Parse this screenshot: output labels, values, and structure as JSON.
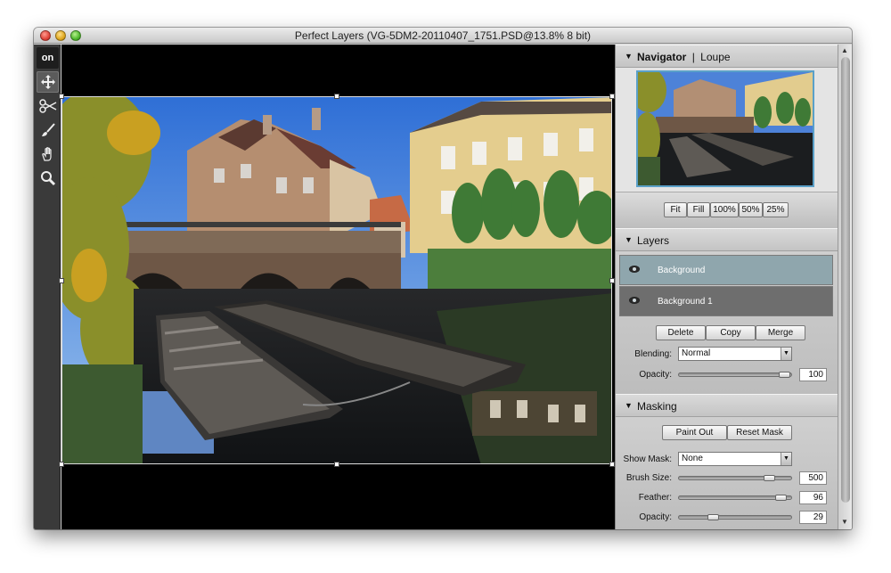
{
  "window": {
    "title": "Perfect Layers (VG-5DM2-20110407_1751.PSD@13.8% 8 bit)"
  },
  "toolbar": {
    "logo_text": "on",
    "tools": [
      {
        "icon": "move-icon",
        "active": true
      },
      {
        "icon": "scissors-icon",
        "active": false
      },
      {
        "icon": "brush-icon",
        "active": false
      },
      {
        "icon": "hand-icon",
        "active": false
      },
      {
        "icon": "zoom-icon",
        "active": false
      }
    ]
  },
  "navigator": {
    "tab_navigator": "Navigator",
    "separator": "|",
    "tab_loupe": "Loupe",
    "buttons": [
      "Fit",
      "Fill",
      "100%",
      "50%",
      "25%"
    ]
  },
  "layers": {
    "title": "Layers",
    "items": [
      {
        "name": "Background",
        "selected": true
      },
      {
        "name": "Background 1",
        "selected": false
      }
    ],
    "buttons": [
      "Delete",
      "Copy",
      "Merge"
    ],
    "blending_label": "Blending:",
    "blending_value": "Normal",
    "opacity_label": "Opacity:",
    "opacity_value": "100",
    "opacity_level": 1.0
  },
  "masking": {
    "title": "Masking",
    "paint_out": "Paint Out",
    "reset_mask": "Reset Mask",
    "show_mask_label": "Show Mask:",
    "show_mask_value": "None",
    "brush_size_label": "Brush Size:",
    "brush_size_value": "500",
    "feather_label": "Feather:",
    "feather_value": "96",
    "opacity_label": "Opacity:",
    "opacity_value": "29",
    "brush_level": 0.85,
    "feather_level": 0.96,
    "opacity_level": 0.29
  },
  "colors": {
    "selected_layer": "#8fa6ad",
    "unselected_layer": "#6e6e6e",
    "canvas_bg": "#000000"
  }
}
